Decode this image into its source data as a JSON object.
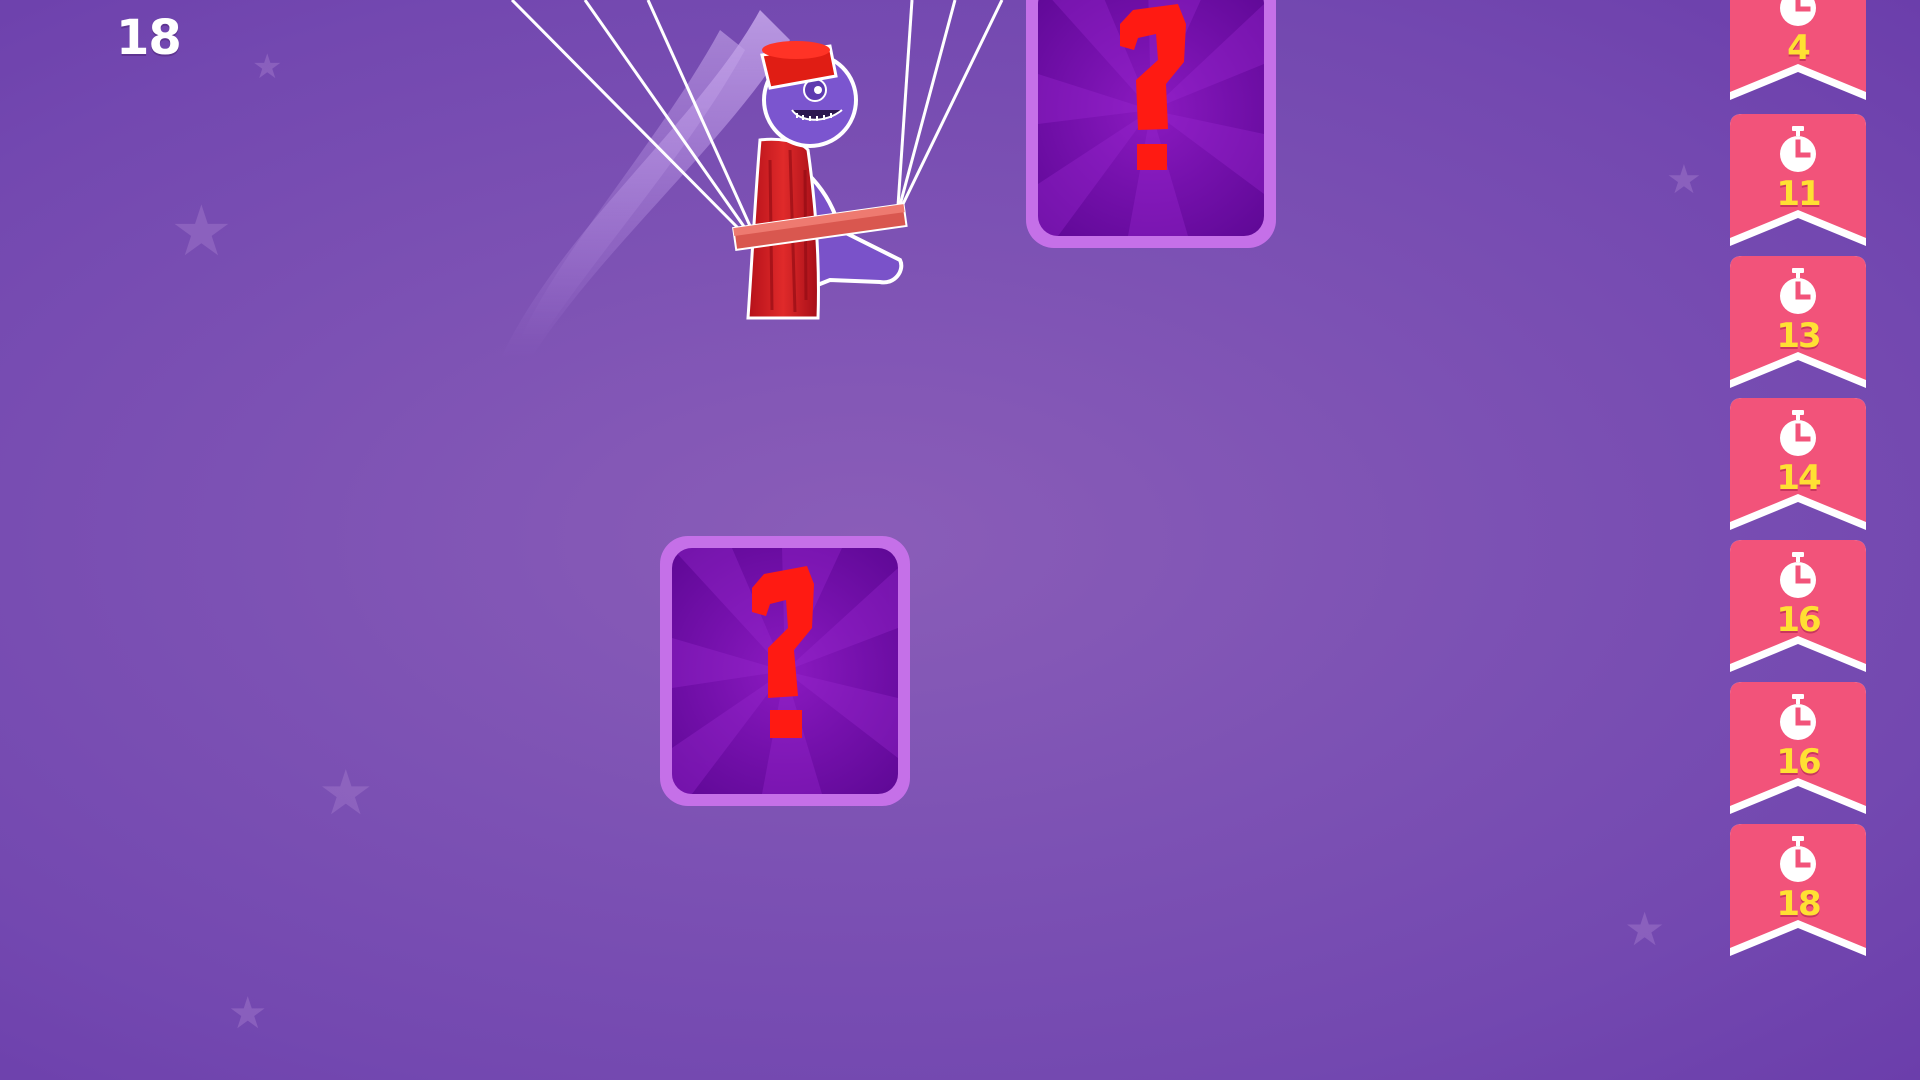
{
  "hud": {
    "score": "18"
  },
  "colors": {
    "background": "#7d52b4",
    "box_border": "#c570e8",
    "box_inner": "#7611ad",
    "question_mark": "#ff1a12",
    "timer_tag": "#f2537a",
    "timer_number": "#ffe033"
  },
  "player": {
    "icon": "parachuting-fez-cyclops-character"
  },
  "mystery_boxes": [
    {
      "icon": "question-mark-icon"
    },
    {
      "icon": "question-mark-icon"
    }
  ],
  "timers": [
    {
      "icon": "stopwatch-icon",
      "value": "4"
    },
    {
      "icon": "stopwatch-icon",
      "value": "11"
    },
    {
      "icon": "stopwatch-icon",
      "value": "13"
    },
    {
      "icon": "stopwatch-icon",
      "value": "14"
    },
    {
      "icon": "stopwatch-icon",
      "value": "16"
    },
    {
      "icon": "stopwatch-icon",
      "value": "16"
    },
    {
      "icon": "stopwatch-icon",
      "value": "18"
    }
  ]
}
